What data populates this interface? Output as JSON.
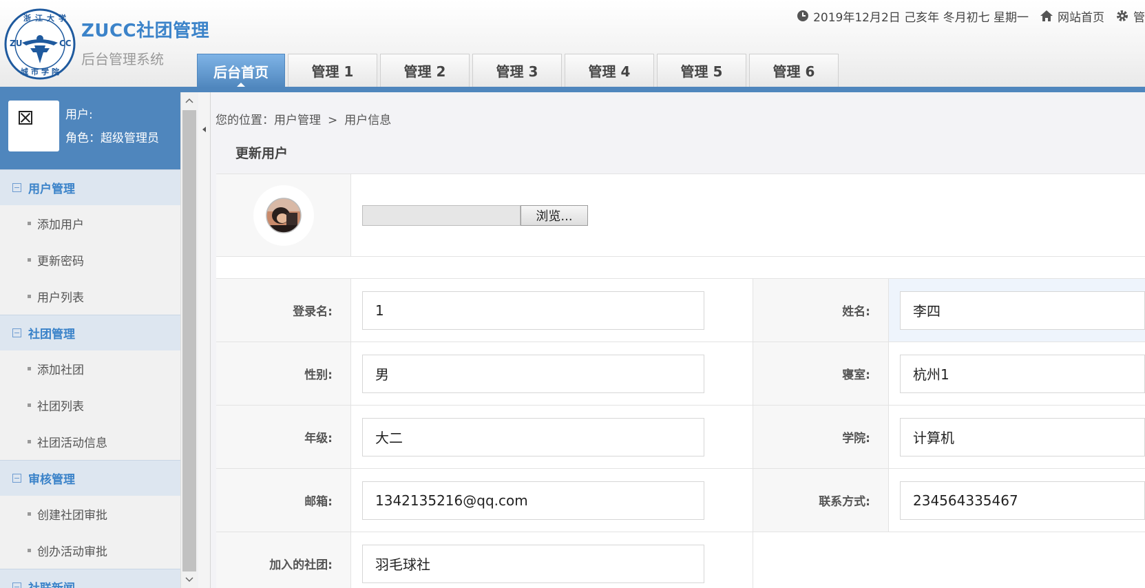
{
  "header": {
    "logo": {
      "text_top": "浙江大学",
      "text_left": "ZU",
      "text_right": "CC",
      "text_bottom": "城市学院"
    },
    "app_title": "ZUCC社团管理",
    "app_subtitle": "后台管理系统",
    "date": "2019年12月2日 己亥年 冬月初七 星期一",
    "home_link": "网站首页",
    "settings_label": "管",
    "tabs": [
      {
        "label": "后台首页",
        "active": true
      },
      {
        "label": "管理 1"
      },
      {
        "label": "管理 2"
      },
      {
        "label": "管理 3"
      },
      {
        "label": "管理 4"
      },
      {
        "label": "管理 5"
      },
      {
        "label": "管理 6"
      }
    ],
    "colors": {
      "accent": "#4f86bd",
      "title": "#3b83c9"
    }
  },
  "sidebar": {
    "user_label": "用户:",
    "role_line": "角色：超级管理员",
    "groups": [
      {
        "title": "用户管理",
        "items": [
          "添加用户",
          "更新密码",
          "用户列表"
        ]
      },
      {
        "title": "社团管理",
        "items": [
          "添加社团",
          "社团列表",
          "社团活动信息"
        ]
      },
      {
        "title": "审核管理",
        "items": [
          "创建社团审批",
          "创办活动审批"
        ]
      },
      {
        "title": "社联新闻",
        "items": []
      }
    ]
  },
  "main": {
    "breadcrumb": {
      "prefix": "您的位置：",
      "level1": "用户管理",
      "sep": ">",
      "level2": "用户信息"
    },
    "section_title": "更新用户",
    "upload": {
      "browse_label": "浏览..."
    },
    "fields": {
      "login": {
        "label": "登录名:",
        "value": "1"
      },
      "name": {
        "label": "姓名:",
        "value": "李四"
      },
      "gender": {
        "label": "性别:",
        "value": "男"
      },
      "dorm": {
        "label": "寝室:",
        "value": "杭州1"
      },
      "grade": {
        "label": "年级:",
        "value": "大二"
      },
      "college": {
        "label": "学院:",
        "value": "计算机"
      },
      "email": {
        "label": "邮箱:",
        "value": "1342135216@qq.com"
      },
      "phone": {
        "label": "联系方式:",
        "value": "234564335467"
      },
      "club": {
        "label": "加入的社团:",
        "value": "羽毛球社"
      }
    }
  }
}
